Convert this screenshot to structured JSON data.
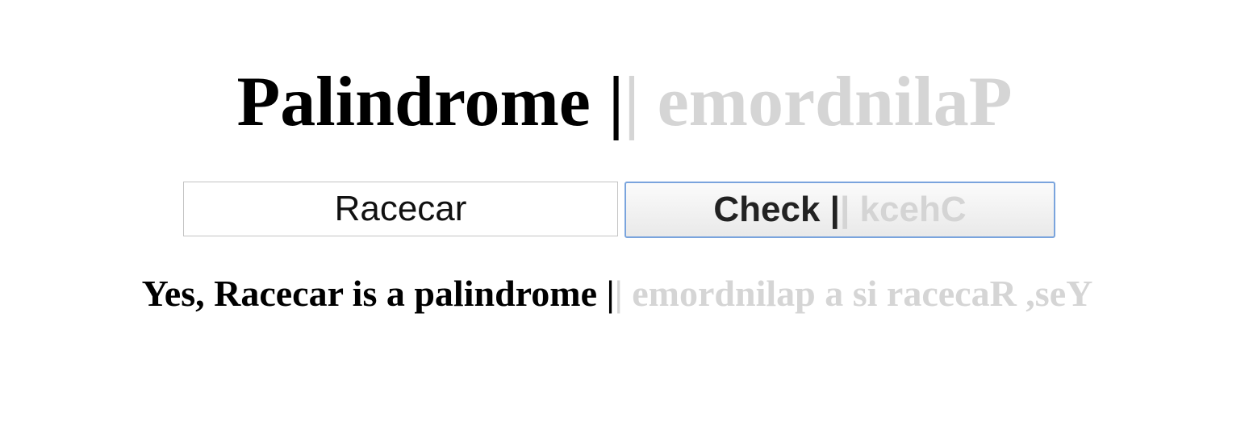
{
  "title": {
    "text": "Palindrome |",
    "mirror": "| emordnilaP"
  },
  "input": {
    "value": "Racecar"
  },
  "check_button": {
    "label": "Check |",
    "mirror": "| kcehC"
  },
  "result": {
    "text": "Yes, Racecar is a palindrome |",
    "mirror": "| emordnilap a si racecaR ,seY"
  },
  "colors": {
    "text": "#000000",
    "mirror_text": "#d5d5d5",
    "button_border": "#7aa4dd",
    "input_border": "#c3c3c3"
  }
}
